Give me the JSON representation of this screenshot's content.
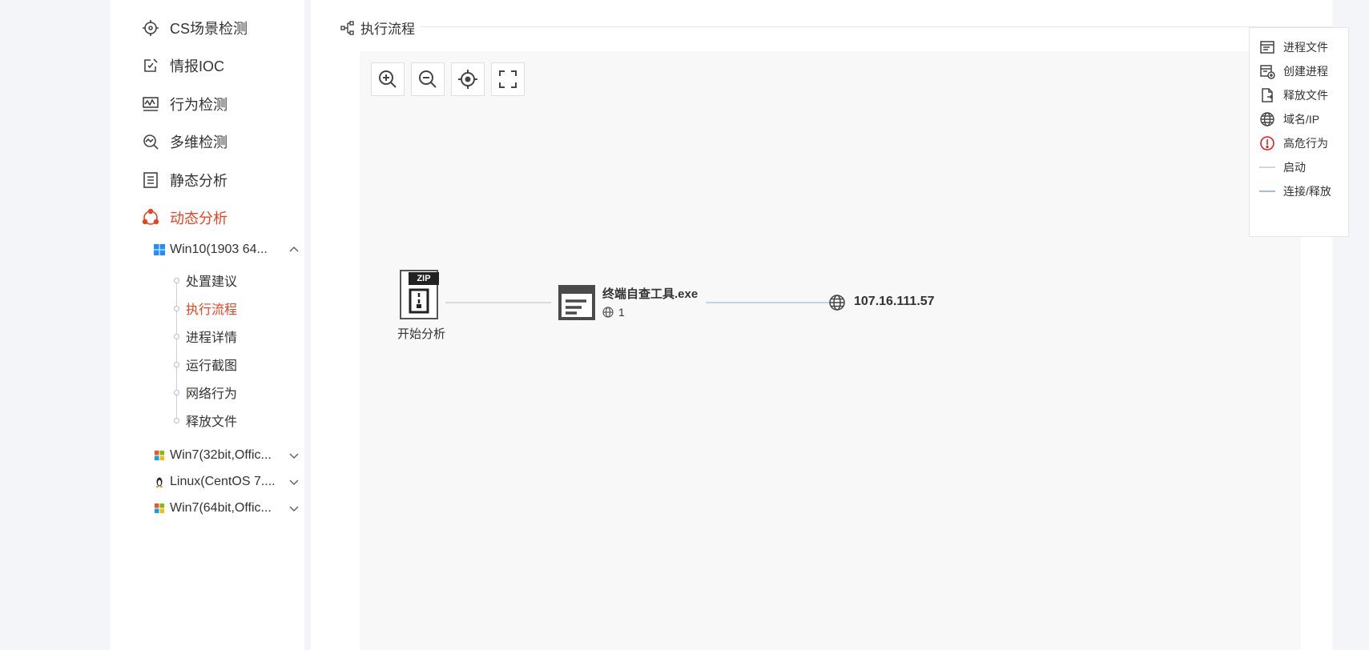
{
  "sidebar": {
    "nav": [
      {
        "label": "CS场景检测",
        "icon": "crosshair-icon"
      },
      {
        "label": "情报IOC",
        "icon": "edit-check-icon"
      },
      {
        "label": "行为检测",
        "icon": "monitor-wave-icon"
      },
      {
        "label": "多维检测",
        "icon": "search-wave-icon"
      },
      {
        "label": "静态分析",
        "icon": "list-doc-icon"
      },
      {
        "label": "动态分析",
        "icon": "share-nodes-icon",
        "active": true
      }
    ],
    "groups": [
      {
        "label": "Win10(1903 64...",
        "expanded": true,
        "children": [
          "处置建议",
          "执行流程",
          "进程详情",
          "运行截图",
          "网络行为",
          "释放文件"
        ],
        "active_child": "执行流程"
      },
      {
        "label": "Win7(32bit,Offic...",
        "expanded": false
      },
      {
        "label": "Linux(CentOS 7....",
        "expanded": false
      },
      {
        "label": "Win7(64bit,Offic...",
        "expanded": false
      }
    ]
  },
  "main": {
    "section_title": "执行流程",
    "toolbar": [
      "zoom-in-icon",
      "zoom-out-icon",
      "locate-icon",
      "fullscreen-icon"
    ],
    "legend": [
      {
        "label": "进程文件",
        "icon": "process-file-icon"
      },
      {
        "label": "创建进程",
        "icon": "create-process-icon"
      },
      {
        "label": "释放文件",
        "icon": "release-file-icon"
      },
      {
        "label": "域名/IP",
        "icon": "globe-icon"
      },
      {
        "label": "高危行为",
        "icon": "alert-circle-icon",
        "color": "#e02020"
      },
      {
        "label": "启动",
        "icon": "gray-line-icon",
        "color": "#c8c8c8"
      },
      {
        "label": "连接/释放",
        "icon": "blue-line-icon",
        "color": "#7ea7e6"
      }
    ],
    "graph": {
      "start_label": "开始分析",
      "zip_text": "ZIP",
      "process_name": "终端自查工具.exe",
      "process_net_count": "1",
      "ip": "107.16.111.57"
    }
  },
  "colors": {
    "accent": "#e8431f",
    "edge_start": "#c8c8c8",
    "edge_connect": "#9bbcf0"
  }
}
